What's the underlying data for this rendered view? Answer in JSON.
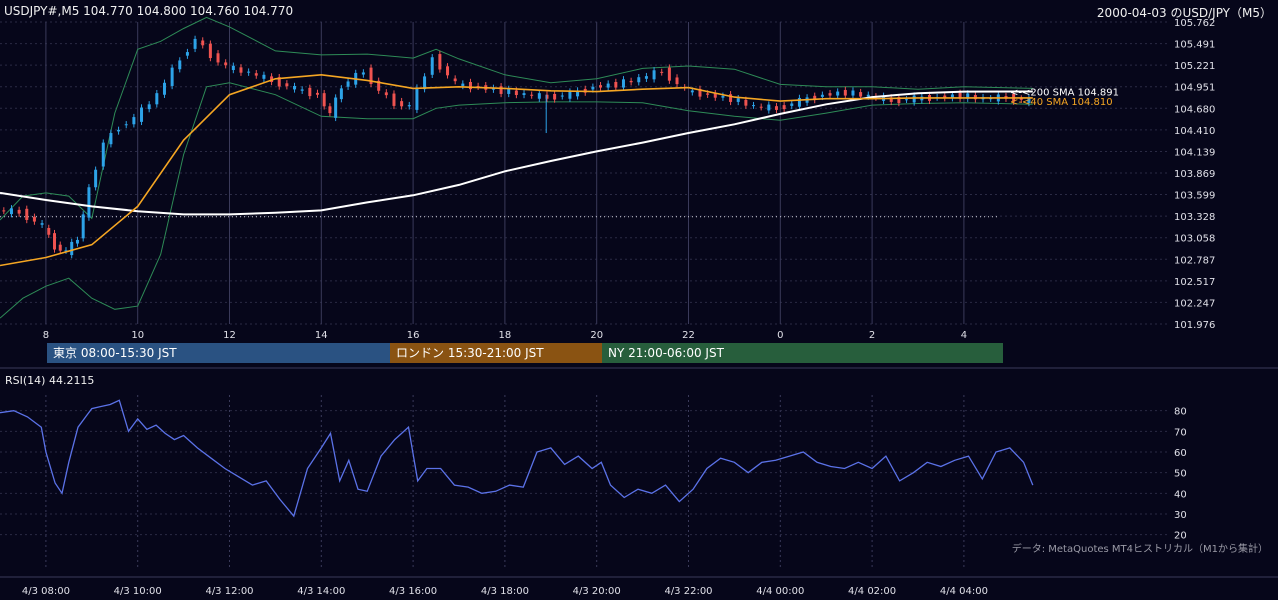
{
  "header": {
    "symbol_line": "USDJPY#,M5 104.770 104.800 104.760 104.770",
    "date_title": "2000-04-03 のUSD/JPY（M5）",
    "rsi_label": "RSI(14) 44.2115",
    "data_source": "データ: MetaQuotes MT4ヒストリカル（M1から集計）"
  },
  "sessions": [
    {
      "label": "東京 08:00-15:30 JST",
      "color": "#2a5282"
    },
    {
      "label": "ロンドン 15:30-21:00 JST",
      "color": "#8a5312"
    },
    {
      "label": "NY 21:00-06:00 JST",
      "color": "#275e3c"
    }
  ],
  "colors": {
    "background": "#06061a",
    "up_candle": "#2da3e8",
    "down_candle": "#ef5350",
    "sma200": "#ffffff",
    "sma40": "#f5a623",
    "bollinger": "#2e8b57",
    "rsi_line": "#5b72e8",
    "grid": "#2a2a44"
  },
  "chart_data": [
    {
      "type": "line",
      "name": "price",
      "price_axis_ticks": [
        "105.762",
        "105.491",
        "105.221",
        "104.951",
        "104.680",
        "104.410",
        "104.139",
        "103.869",
        "103.599",
        "103.328",
        "103.058",
        "102.787",
        "102.517",
        "102.247",
        "101.976"
      ],
      "ylim": [
        101.976,
        105.762
      ],
      "hour_axis_ticks": [
        "8",
        "10",
        "12",
        "14",
        "16",
        "18",
        "20",
        "22",
        "0",
        "2",
        "4"
      ],
      "reference_line": 103.32,
      "annotations": [
        "<-<200 SMA 104.891",
        "<-<40 SMA 104.810"
      ],
      "sma200": {
        "x": [
          "4/3 07:00",
          "4/3 08:00",
          "4/3 09:00",
          "4/3 10:00",
          "4/3 11:00",
          "4/3 12:00",
          "4/3 13:00",
          "4/3 14:00",
          "4/3 15:00",
          "4/3 16:00",
          "4/3 17:00",
          "4/3 18:00",
          "4/3 19:00",
          "4/3 20:00",
          "4/3 21:00",
          "4/3 22:00",
          "4/3 23:00",
          "4/4 00:00",
          "4/4 01:00",
          "4/4 02:00",
          "4/4 03:00",
          "4/4 04:00",
          "4/4 05:30"
        ],
        "values": [
          103.62,
          103.53,
          103.45,
          103.39,
          103.35,
          103.35,
          103.37,
          103.4,
          103.5,
          103.59,
          103.72,
          103.89,
          104.02,
          104.14,
          104.25,
          104.37,
          104.48,
          104.61,
          104.73,
          104.82,
          104.87,
          104.89,
          104.891
        ]
      },
      "sma40": {
        "x": [
          "4/3 07:00",
          "4/3 08:00",
          "4/3 09:00",
          "4/3 10:00",
          "4/3 11:00",
          "4/3 12:00",
          "4/3 13:00",
          "4/3 14:00",
          "4/3 15:00",
          "4/3 16:00",
          "4/3 17:00",
          "4/3 18:00",
          "4/3 19:00",
          "4/3 20:00",
          "4/3 21:00",
          "4/3 22:00",
          "4/3 23:00",
          "4/4 00:00",
          "4/4 01:00",
          "4/4 02:00",
          "4/4 03:00",
          "4/4 04:00",
          "4/4 05:30"
        ],
        "values": [
          102.71,
          102.81,
          102.97,
          103.45,
          104.28,
          104.85,
          105.05,
          105.1,
          105.03,
          104.93,
          104.95,
          104.93,
          104.9,
          104.89,
          104.92,
          104.94,
          104.82,
          104.77,
          104.8,
          104.8,
          104.81,
          104.81,
          104.81
        ]
      },
      "bollinger_upper": {
        "x": [
          "4/3 07:00",
          "4/3 07:30",
          "4/3 08:00",
          "4/3 08:30",
          "4/3 09:00",
          "4/3 09:30",
          "4/3 10:00",
          "4/3 10:30",
          "4/3 11:00",
          "4/3 11:30",
          "4/3 12:00",
          "4/3 13:00",
          "4/3 14:00",
          "4/3 15:00",
          "4/3 16:00",
          "4/3 16:30",
          "4/3 17:00",
          "4/3 18:00",
          "4/3 19:00",
          "4/3 20:00",
          "4/3 21:00",
          "4/3 22:00",
          "4/3 23:00",
          "4/4 00:00",
          "4/4 01:00",
          "4/4 02:00",
          "4/4 03:00",
          "4/4 04:00",
          "4/4 05:30"
        ],
        "values": [
          103.28,
          103.58,
          103.62,
          103.58,
          103.3,
          104.62,
          105.42,
          105.52,
          105.68,
          105.82,
          105.7,
          105.4,
          105.35,
          105.36,
          105.31,
          105.42,
          105.3,
          105.1,
          105.0,
          105.05,
          105.18,
          105.21,
          105.17,
          104.98,
          104.95,
          104.95,
          104.92,
          104.95,
          104.93
        ]
      },
      "bollinger_lower": {
        "x": [
          "4/3 07:00",
          "4/3 07:30",
          "4/3 08:00",
          "4/3 08:30",
          "4/3 09:00",
          "4/3 09:30",
          "4/3 10:00",
          "4/3 10:30",
          "4/3 11:00",
          "4/3 11:30",
          "4/3 12:00",
          "4/3 13:00",
          "4/3 14:00",
          "4/3 15:00",
          "4/3 16:00",
          "4/3 16:30",
          "4/3 17:00",
          "4/3 18:00",
          "4/3 19:00",
          "4/3 20:00",
          "4/3 21:00",
          "4/3 22:00",
          "4/3 23:00",
          "4/4 00:00",
          "4/4 01:00",
          "4/4 02:00",
          "4/4 03:00",
          "4/4 04:00",
          "4/4 05:30"
        ],
        "values": [
          102.05,
          102.3,
          102.45,
          102.55,
          102.3,
          102.16,
          102.2,
          102.85,
          104.1,
          104.95,
          105.0,
          104.85,
          104.58,
          104.55,
          104.55,
          104.68,
          104.72,
          104.75,
          104.76,
          104.76,
          104.75,
          104.65,
          104.58,
          104.53,
          104.62,
          104.72,
          104.74,
          104.75,
          104.73
        ]
      },
      "price_close": {
        "x": [
          "4/3 07:00",
          "4/3 07:30",
          "4/3 08:00",
          "4/3 08:15",
          "4/3 08:30",
          "4/3 08:45",
          "4/3 09:00",
          "4/3 09:20",
          "4/3 09:40",
          "4/3 10:00",
          "4/3 10:30",
          "4/3 11:00",
          "4/3 11:20",
          "4/3 11:40",
          "4/3 12:00",
          "4/3 12:30",
          "4/3 13:00",
          "4/3 13:30",
          "4/3 14:00",
          "4/3 14:15",
          "4/3 14:30",
          "4/3 15:00",
          "4/3 15:20",
          "4/3 15:40",
          "4/3 16:00",
          "4/3 16:20",
          "4/3 16:30",
          "4/3 17:00",
          "4/3 17:30",
          "4/3 18:00",
          "4/3 18:30",
          "4/3 19:00",
          "4/3 19:30",
          "4/3 20:00",
          "4/3 20:30",
          "4/3 21:00",
          "4/3 21:30",
          "4/3 22:00",
          "4/3 22:30",
          "4/3 23:00",
          "4/3 23:30",
          "4/4 00:00",
          "4/4 00:30",
          "4/4 01:00",
          "4/4 01:30",
          "4/4 02:00",
          "4/4 02:30",
          "4/4 03:00",
          "4/4 03:30",
          "4/4 04:00",
          "4/4 04:30",
          "4/4 05:00",
          "4/4 05:30"
        ],
        "values": [
          103.4,
          103.38,
          103.2,
          102.95,
          102.88,
          103.05,
          103.65,
          104.25,
          104.45,
          104.55,
          104.85,
          105.3,
          105.55,
          105.35,
          105.2,
          105.12,
          105.03,
          104.92,
          104.85,
          104.6,
          104.95,
          105.15,
          104.9,
          104.75,
          104.7,
          105.1,
          105.32,
          104.98,
          104.95,
          104.9,
          104.85,
          104.82,
          104.85,
          104.95,
          104.98,
          105.05,
          105.15,
          104.9,
          104.85,
          104.8,
          104.7,
          104.68,
          104.77,
          104.85,
          104.88,
          104.83,
          104.78,
          104.8,
          104.82,
          104.84,
          104.8,
          104.82,
          104.77
        ]
      }
    },
    {
      "type": "line",
      "name": "RSI(14)",
      "ylim": [
        15,
        90
      ],
      "yticks": [
        "80",
        "70",
        "60",
        "50",
        "40",
        "30",
        "20"
      ],
      "x_ticks": [
        "4/3 08:00",
        "4/3 10:00",
        "4/3 12:00",
        "4/3 14:00",
        "4/3 16:00",
        "4/3 18:00",
        "4/3 20:00",
        "4/3 22:00",
        "4/4 00:00",
        "4/4 02:00",
        "4/4 04:00"
      ],
      "x_tick_labels": [
        "4/3 08:00",
        "4/3 10:00",
        "4/3 12:00",
        "4/3 14:00",
        "4/3 16:00",
        "4/3 18:00",
        "4/3 20:00",
        "4/3 22:00",
        "4/4 00:00",
        "4/4 02:00",
        "4/4 04:00"
      ],
      "x_tick_positions_hours": [
        1,
        3,
        5,
        7,
        9,
        11,
        13,
        15,
        17,
        19,
        21
      ],
      "rsi": {
        "x_hours": [
          0,
          0.3,
          0.6,
          0.9,
          1.0,
          1.2,
          1.35,
          1.5,
          1.7,
          1.9,
          2.0,
          2.2,
          2.4,
          2.6,
          2.8,
          3.0,
          3.2,
          3.4,
          3.6,
          3.8,
          4.0,
          4.3,
          4.6,
          4.9,
          5.2,
          5.5,
          5.8,
          6.1,
          6.4,
          6.7,
          7.0,
          7.2,
          7.4,
          7.6,
          7.8,
          8.0,
          8.3,
          8.6,
          8.9,
          9.1,
          9.3,
          9.6,
          9.9,
          10.2,
          10.5,
          10.8,
          11.1,
          11.4,
          11.7,
          12.0,
          12.3,
          12.6,
          12.9,
          13.1,
          13.3,
          13.6,
          13.9,
          14.2,
          14.5,
          14.8,
          15.1,
          15.4,
          15.7,
          16.0,
          16.3,
          16.6,
          16.9,
          17.2,
          17.5,
          17.8,
          18.1,
          18.4,
          18.7,
          19.0,
          19.3,
          19.6,
          19.9,
          20.2,
          20.5,
          20.8,
          21.1,
          21.4,
          21.7,
          22.0,
          22.3,
          22.5
        ],
        "values": [
          79,
          80,
          77,
          72,
          60,
          45,
          40,
          55,
          72,
          78,
          81,
          82,
          83,
          85,
          70,
          76,
          71,
          73,
          69,
          66,
          68,
          62,
          57,
          52,
          48,
          44,
          46,
          37,
          29,
          52,
          62,
          69,
          46,
          56,
          42,
          41,
          58,
          66,
          72,
          46,
          52,
          52,
          44,
          43,
          40,
          41,
          44,
          43,
          60,
          62,
          54,
          58,
          52,
          55,
          44,
          38,
          42,
          40,
          44,
          36,
          42,
          52,
          57,
          55,
          50,
          55,
          56,
          58,
          60,
          55,
          53,
          52,
          55,
          52,
          58,
          46,
          50,
          55,
          53,
          56,
          58,
          47,
          60,
          62,
          55,
          44
        ]
      }
    }
  ]
}
